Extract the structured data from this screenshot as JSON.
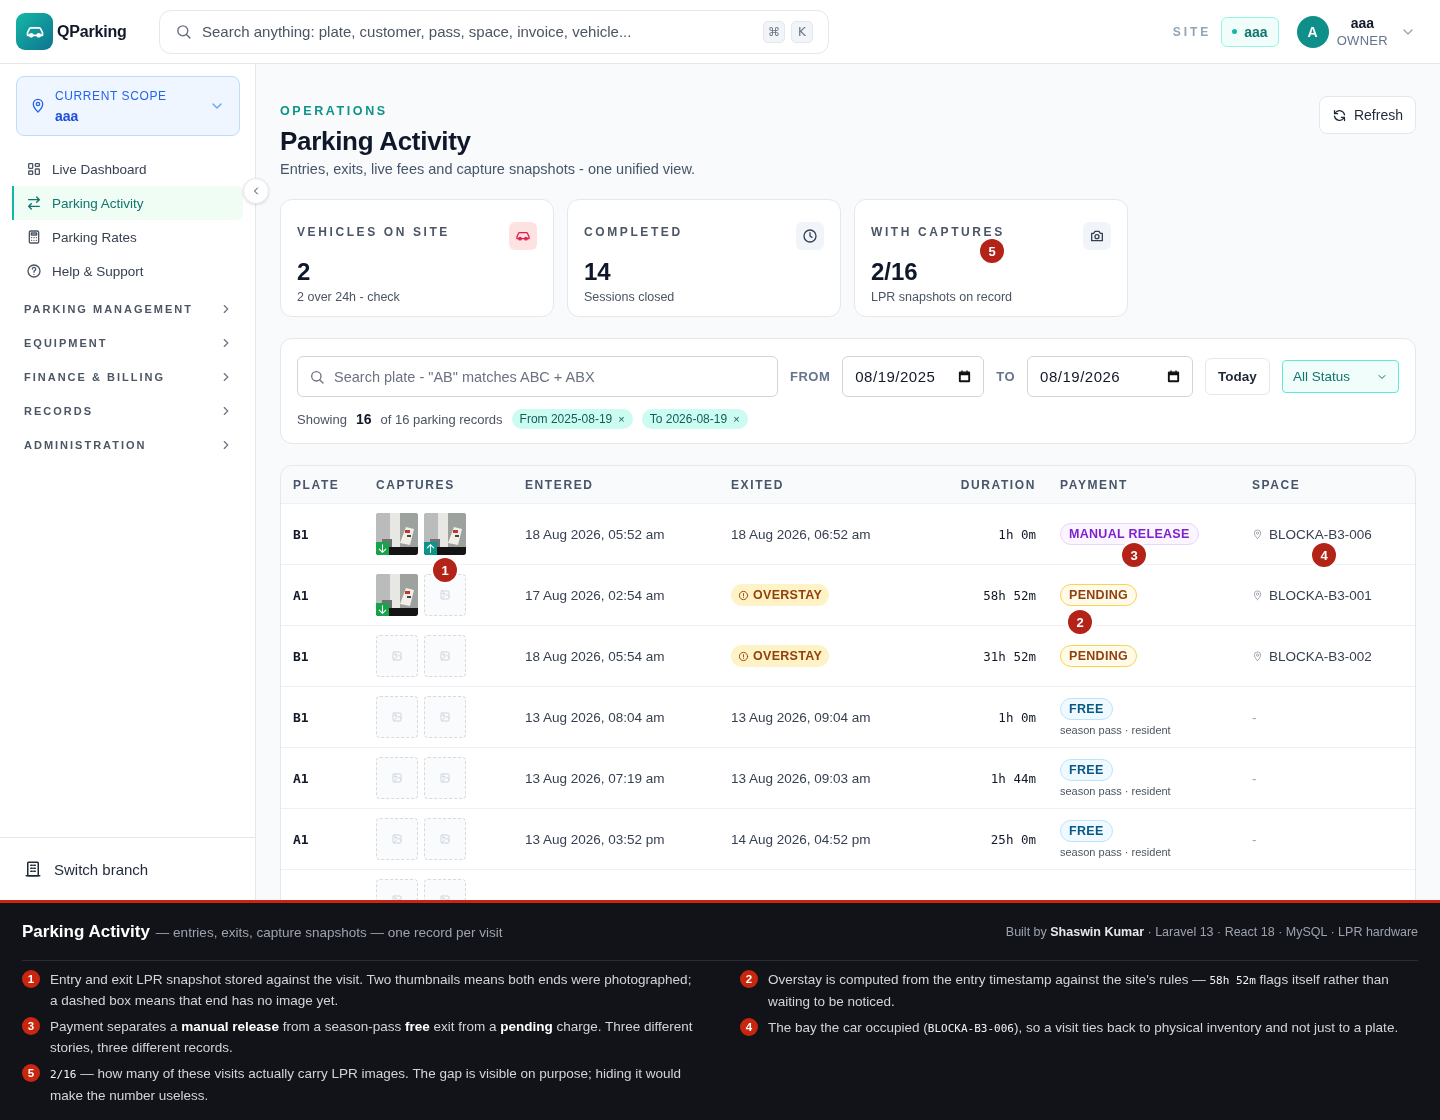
{
  "brand": {
    "name": "QParking"
  },
  "search": {
    "placeholder": "Search anything: plate, customer, pass, space, invoice, vehicle...",
    "keys": [
      "⌘",
      "K"
    ]
  },
  "site": {
    "label": "SITE",
    "value": "aaa"
  },
  "user": {
    "initial": "A",
    "name": "aaa",
    "role": "OWNER"
  },
  "scope": {
    "label": "CURRENT SCOPE",
    "value": "aaa"
  },
  "nav": [
    {
      "kind": "grid",
      "label": "Live Dashboard",
      "selected": false
    },
    {
      "kind": "swap",
      "label": "Parking Activity",
      "selected": true
    },
    {
      "kind": "calculator",
      "label": "Parking Rates",
      "selected": false
    },
    {
      "kind": "help",
      "label": "Help & Support",
      "selected": false
    }
  ],
  "sections": [
    "PARKING MANAGEMENT",
    "EQUIPMENT",
    "FINANCE & BILLING",
    "RECORDS",
    "ADMINISTRATION"
  ],
  "switch_branch": "Switch branch",
  "page": {
    "eyebrow": "OPERATIONS",
    "title": "Parking Activity",
    "subtitle": "Entries, exits, live fees and capture snapshots - one unified view.",
    "refresh": "Refresh"
  },
  "stats": [
    {
      "kind": "car",
      "label": "VEHICLES ON SITE",
      "value": "2",
      "note": "2 over 24h - check"
    },
    {
      "kind": "clock",
      "label": "COMPLETED",
      "value": "14",
      "note": "Sessions closed"
    },
    {
      "kind": "camera",
      "label": "WITH CAPTURES",
      "value": "2/16",
      "note": "LPR snapshots on record",
      "marker": "5"
    }
  ],
  "filters": {
    "search_placeholder": "Search plate - \"AB\" matches ABC + ABX",
    "from_label": "FROM",
    "from": "08/19/2025",
    "to_label": "TO",
    "to": "08/19/2026",
    "today": "Today",
    "status": "All Status",
    "showing": "Showing",
    "count": "16",
    "of_total": "of 16 parking records",
    "chips": [
      {
        "label": "From 2025-08-19",
        "remove": "×"
      },
      {
        "label": "To 2026-08-19",
        "remove": "×"
      }
    ]
  },
  "table": {
    "columns": [
      "PLATE",
      "CAPTURES",
      "ENTERED",
      "EXITED",
      "DURATION",
      "PAYMENT",
      "SPACE"
    ],
    "rows": [
      {
        "plate": "B1",
        "captures": [
          {
            "kind": "entry-photo"
          },
          {
            "kind": "exit-photo"
          }
        ],
        "capture_marker": "1",
        "entered": "18 Aug 2026, 05:52 am",
        "exited": {
          "kind": "time",
          "text": "18 Aug 2026, 06:52 am"
        },
        "duration": "1h 0m",
        "payment": {
          "kind": "manual",
          "label": "MANUAL RELEASE",
          "marker": "3"
        },
        "space": {
          "kind": "bay",
          "text": "BLOCKA-B3-006",
          "marker": "4"
        }
      },
      {
        "plate": "A1",
        "captures": [
          {
            "kind": "entry-photo"
          },
          {
            "kind": "empty"
          }
        ],
        "entered": "17 Aug 2026, 02:54 am",
        "exited": {
          "kind": "overstay",
          "text": "OVERSTAY"
        },
        "duration": "58h 52m",
        "payment": {
          "kind": "pending",
          "label": "PENDING",
          "marker": "2"
        },
        "space": {
          "kind": "bay",
          "text": "BLOCKA-B3-001"
        }
      },
      {
        "plate": "B1",
        "captures": [
          {
            "kind": "empty"
          },
          {
            "kind": "empty"
          }
        ],
        "entered": "18 Aug 2026, 05:54 am",
        "exited": {
          "kind": "overstay",
          "text": "OVERSTAY"
        },
        "duration": "31h 52m",
        "payment": {
          "kind": "pending",
          "label": "PENDING"
        },
        "space": {
          "kind": "bay",
          "text": "BLOCKA-B3-002"
        }
      },
      {
        "plate": "B1",
        "captures": [
          {
            "kind": "empty"
          },
          {
            "kind": "empty"
          }
        ],
        "entered": "13 Aug 2026, 08:04 am",
        "exited": {
          "kind": "time",
          "text": "13 Aug 2026, 09:04 am"
        },
        "duration": "1h 0m",
        "payment": {
          "kind": "free",
          "label": "FREE",
          "note": "season pass · resident"
        },
        "space": {
          "kind": "none",
          "text": "-"
        }
      },
      {
        "plate": "A1",
        "captures": [
          {
            "kind": "empty"
          },
          {
            "kind": "empty"
          }
        ],
        "entered": "13 Aug 2026, 07:19 am",
        "exited": {
          "kind": "time",
          "text": "13 Aug 2026, 09:03 am"
        },
        "duration": "1h 44m",
        "payment": {
          "kind": "free",
          "label": "FREE",
          "note": "season pass · resident"
        },
        "space": {
          "kind": "none",
          "text": "-"
        }
      },
      {
        "plate": "A1",
        "captures": [
          {
            "kind": "empty"
          },
          {
            "kind": "empty"
          }
        ],
        "entered": "13 Aug 2026, 03:52 pm",
        "exited": {
          "kind": "time",
          "text": "14 Aug 2026, 04:52 pm"
        },
        "duration": "25h 0m",
        "payment": {
          "kind": "free",
          "label": "FREE",
          "note": "season pass · resident"
        },
        "space": {
          "kind": "none",
          "text": "-"
        }
      },
      {
        "captures": [
          {
            "kind": "empty"
          },
          {
            "kind": "empty"
          }
        ]
      }
    ]
  },
  "footer": {
    "title": "Parking Activity",
    "subtitle": "— entries, exits, capture snapshots — one record per visit",
    "credit": "Built by **Shaswin Kumar** · Laravel 13 · React 18 · MySQL · LPR hardware",
    "columns": [
      [
        {
          "number": "1",
          "parts": [
            {
              "kind": "text",
              "text": "Entry and exit LPR snapshot stored against the visit. Two thumbnails means both ends were photographed; a dashed box means that end has no image yet."
            }
          ]
        },
        {
          "number": "3",
          "parts": [
            {
              "kind": "text",
              "text": "Payment separates a **manual release** from a season-pass **free** exit from a **pending** charge. Three different stories, three different records."
            }
          ]
        },
        {
          "number": "5",
          "parts": [
            {
              "kind": "code",
              "text": "2/16"
            },
            {
              "kind": "text",
              "text": " — how many of these visits actually carry LPR images. The gap is visible on purpose; hiding it would make the number useless."
            }
          ]
        }
      ],
      [
        {
          "number": "2",
          "parts": [
            {
              "kind": "text",
              "text": "Overstay is computed from the entry timestamp against the site's rules — "
            },
            {
              "kind": "code",
              "text": "58h 52m"
            },
            {
              "kind": "text",
              "text": " flags itself rather than waiting to be noticed."
            }
          ]
        },
        {
          "number": "4",
          "parts": [
            {
              "kind": "text",
              "text": "The bay the car occupied ("
            },
            {
              "kind": "code",
              "text": "BLOCKA-B3-006"
            },
            {
              "kind": "text",
              "text": "), so a visit ties back to physical inventory and not just to a plate."
            }
          ]
        }
      ]
    ]
  }
}
